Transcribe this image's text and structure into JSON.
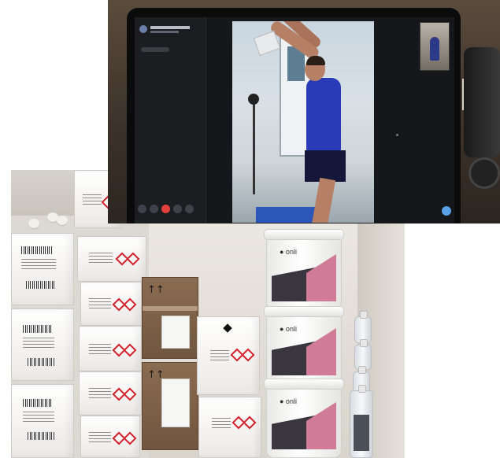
{
  "scene": {
    "description_free": true
  },
  "laptop": {
    "call": {
      "controls": [
        "camera-icon",
        "mic-icon",
        "end-call-icon",
        "screen-share-icon",
        "more-icon"
      ]
    },
    "colors": {
      "end_call": "#e0413d",
      "shirt": "#2a3bb8",
      "bubble": "#5aa0e6"
    }
  },
  "shelf": {
    "logos": [
      {
        "brand_art": "onli"
      },
      {
        "brand_art": "onli"
      },
      {
        "brand_art": "onli"
      }
    ],
    "colors": {
      "hazard": "#d21f2a",
      "bucket_pink": "#d07b98",
      "bucket_dark": "#3a3640"
    }
  }
}
